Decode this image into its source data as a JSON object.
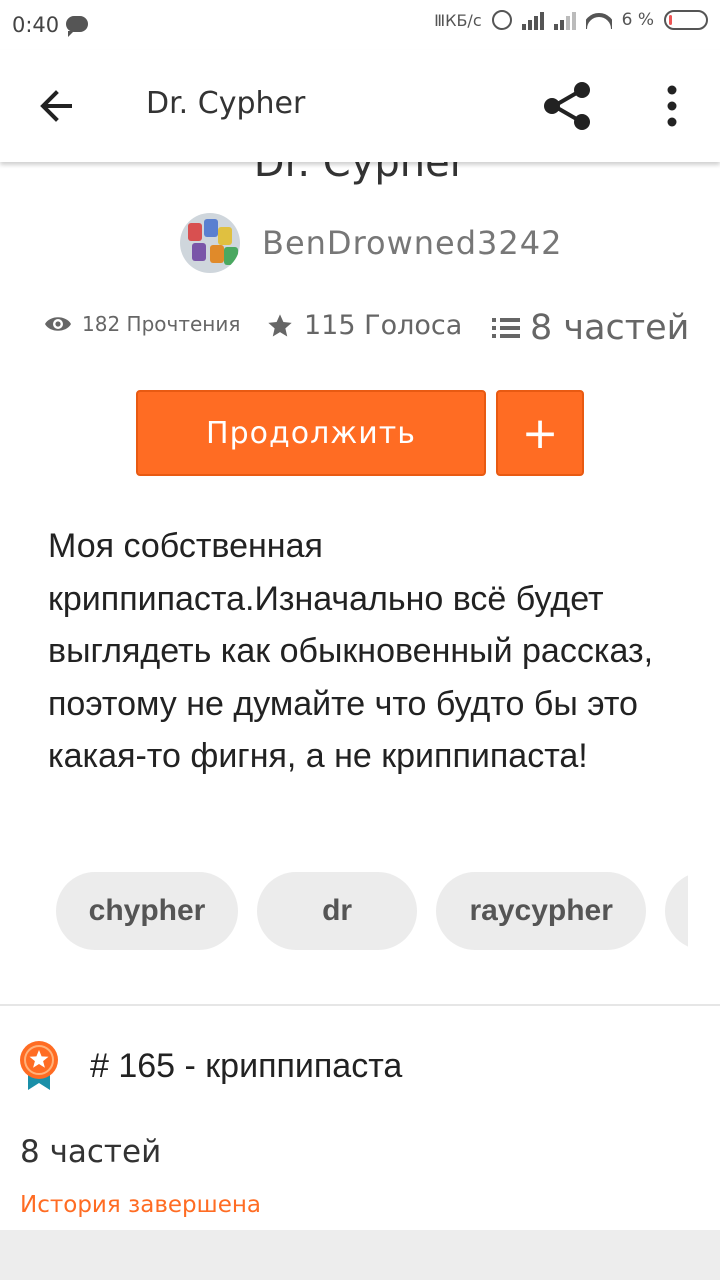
{
  "status_bar": {
    "time": "0:40",
    "net_speed": "ⅢКБ/с",
    "battery_percent": "6 %"
  },
  "app_bar": {
    "title": "Dr. Cypher",
    "back_icon": "arrow-left-icon",
    "share_icon": "share-icon",
    "more_icon": "more-vertical-icon"
  },
  "story": {
    "cut_title": "Dr. Cypher",
    "author": "BenDrowned3242",
    "stats": {
      "reads": "182 Прочтения",
      "votes": "115 Голоса",
      "parts": "8 частей"
    },
    "continue_label": "Продолжить",
    "add_label": "+",
    "description": "Моя собственная криппипаста.Изначально всё будет выглядеть как обыкновенный рассказ, поэтому не думайте что будто бы это какая-то фигня, а не криппипаста!",
    "tags": [
      "chypher",
      "dr",
      "raycypher",
      ""
    ],
    "rank": "# 165 - криппипаста",
    "parts_count": "8 частей",
    "completion_status": "История завершена"
  },
  "colors": {
    "accent": "#ff6c23",
    "tag_bg": "#ececec",
    "text_primary": "#222222",
    "text_secondary": "#666666"
  }
}
